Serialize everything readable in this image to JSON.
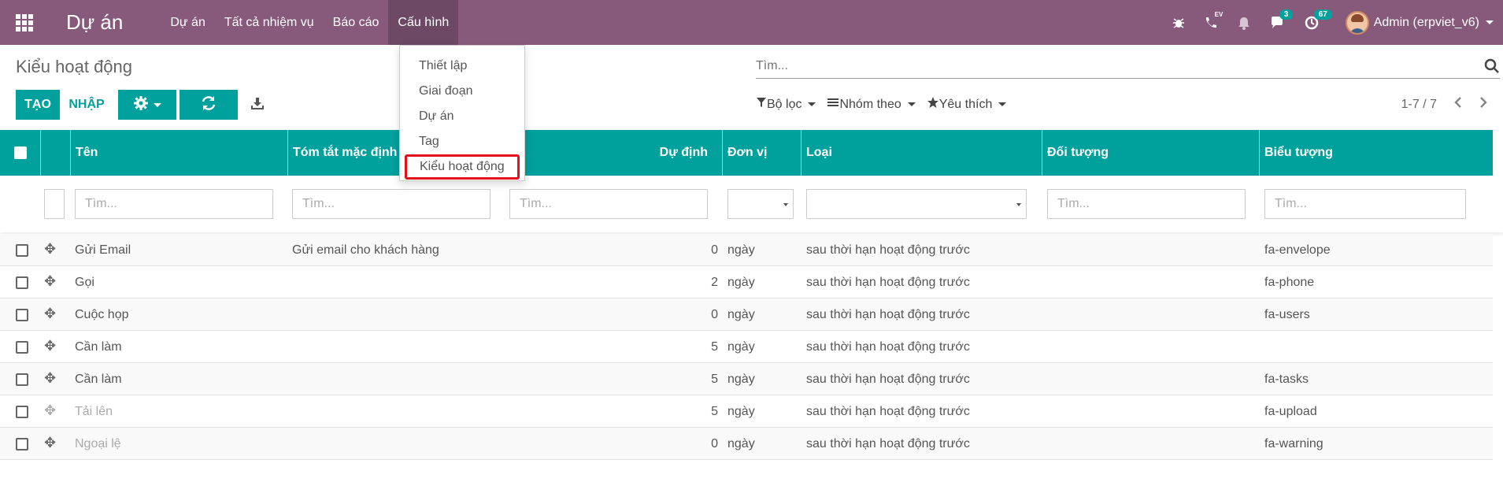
{
  "navbar": {
    "brand": "Dự án",
    "menu": [
      "Dự án",
      "Tất cả nhiệm vụ",
      "Báo cáo",
      "Cấu hình"
    ],
    "active_menu_index": 3,
    "systray": {
      "bug_icon": "bug-icon",
      "phone_label": "EV",
      "messages_count": "3",
      "activities_count": "67",
      "user_name": "Admin (erpviet_v6)"
    }
  },
  "control_panel": {
    "breadcrumb": "Kiểu hoạt động",
    "search_placeholder": "Tìm...",
    "create_label": "TẠO",
    "import_label": "NHẬP",
    "filters": {
      "filter_label": "Bộ lọc",
      "group_label": "Nhóm theo",
      "fav_label": "Yêu thích"
    },
    "pager": "1-7 / 7"
  },
  "dropdown": {
    "items": [
      "Thiết lập",
      "Giai đoạn",
      "Dự án",
      "Tag",
      "Kiểu hoạt động"
    ],
    "highlighted_index": 4
  },
  "table": {
    "columns": [
      "Tên",
      "Tóm tắt mặc định",
      "Dự định",
      "Đơn vị",
      "Loại",
      "Đối tượng",
      "Biểu tượng"
    ],
    "filter_placeholder": "Tìm...",
    "rows": [
      {
        "name": "Gửi Email",
        "summary": "Gửi email cho khách hàng",
        "planned": "0",
        "unit": "ngày",
        "type": "sau thời hạn hoạt động trước",
        "object": "",
        "icon": "fa-envelope"
      },
      {
        "name": "Gọi",
        "summary": "",
        "planned": "2",
        "unit": "ngày",
        "type": "sau thời hạn hoạt động trước",
        "object": "",
        "icon": "fa-phone"
      },
      {
        "name": "Cuộc họp",
        "summary": "",
        "planned": "0",
        "unit": "ngày",
        "type": "sau thời hạn hoạt động trước",
        "object": "",
        "icon": "fa-users"
      },
      {
        "name": "Cần làm",
        "summary": "",
        "planned": "5",
        "unit": "ngày",
        "type": "sau thời hạn hoạt động trước",
        "object": "",
        "icon": ""
      },
      {
        "name": "Cần làm",
        "summary": "",
        "planned": "5",
        "unit": "ngày",
        "type": "sau thời hạn hoạt động trước",
        "object": "",
        "icon": "fa-tasks"
      },
      {
        "name": "Tải lên",
        "summary": "",
        "planned": "5",
        "unit": "ngày",
        "type": "sau thời hạn hoạt động trước",
        "object": "",
        "icon": "fa-upload"
      },
      {
        "name": "Ngoại lệ",
        "summary": "",
        "planned": "0",
        "unit": "ngày",
        "type": "sau thời hạn hoạt động trước",
        "object": "",
        "icon": "fa-warning"
      }
    ]
  },
  "colors": {
    "navbar": "#875a7b",
    "primary": "#00a09d",
    "highlight_border": "#e3111b"
  }
}
